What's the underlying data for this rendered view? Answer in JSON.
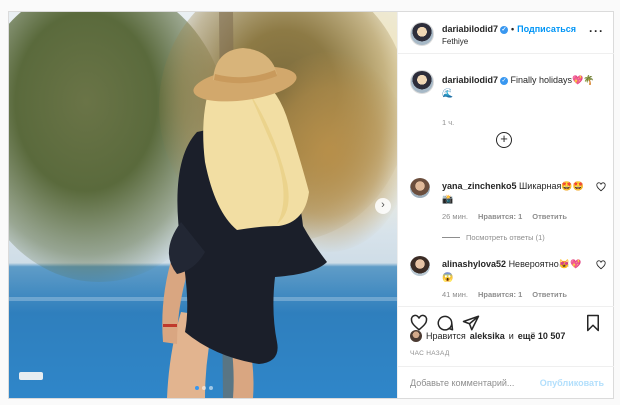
{
  "post": {
    "username": "dariabilodid7",
    "follow_label": "Подписаться",
    "separator": "•",
    "location": "Fethiye",
    "more_glyph": "···"
  },
  "caption": {
    "username": "dariabilodid7",
    "text": "Finally holidays",
    "emojis": "💖🌴🌊",
    "time": "1 ч."
  },
  "load_more_glyph": "+",
  "comments": [
    {
      "username": "yana_zinchenko5",
      "text": "Шикарная",
      "emojis": "🤩🤩📸",
      "time": "26 мин.",
      "likes": "Нравится: 1",
      "reply": "Ответить",
      "view_replies": "Посмотреть ответы (1)"
    },
    {
      "username": "alinashylova52",
      "text": "Невероятно",
      "emojis": "😻💖😱",
      "time": "41 мин.",
      "likes": "Нравится: 1",
      "reply": "Ответить"
    }
  ],
  "likes": {
    "prefix": "Нравится",
    "user": "aleksika",
    "middle": "и",
    "others": "ещё 10 507"
  },
  "time_ago": "ЧАС НАЗАД",
  "add_comment": {
    "placeholder": "Добавьте комментарий...",
    "publish": "Опубликовать"
  },
  "nav_arrow_glyph": "›",
  "carousel": {
    "count": 3,
    "active": 1
  },
  "colors": {
    "accent": "#0095f6",
    "verified": "#3897f0",
    "muted": "#8e8e8e",
    "border": "#dbdbdb"
  },
  "icons": [
    "verified-icon",
    "more-icon",
    "heart-icon",
    "comment-icon",
    "share-icon",
    "bookmark-icon",
    "plus-circle-icon",
    "next-arrow-icon"
  ]
}
